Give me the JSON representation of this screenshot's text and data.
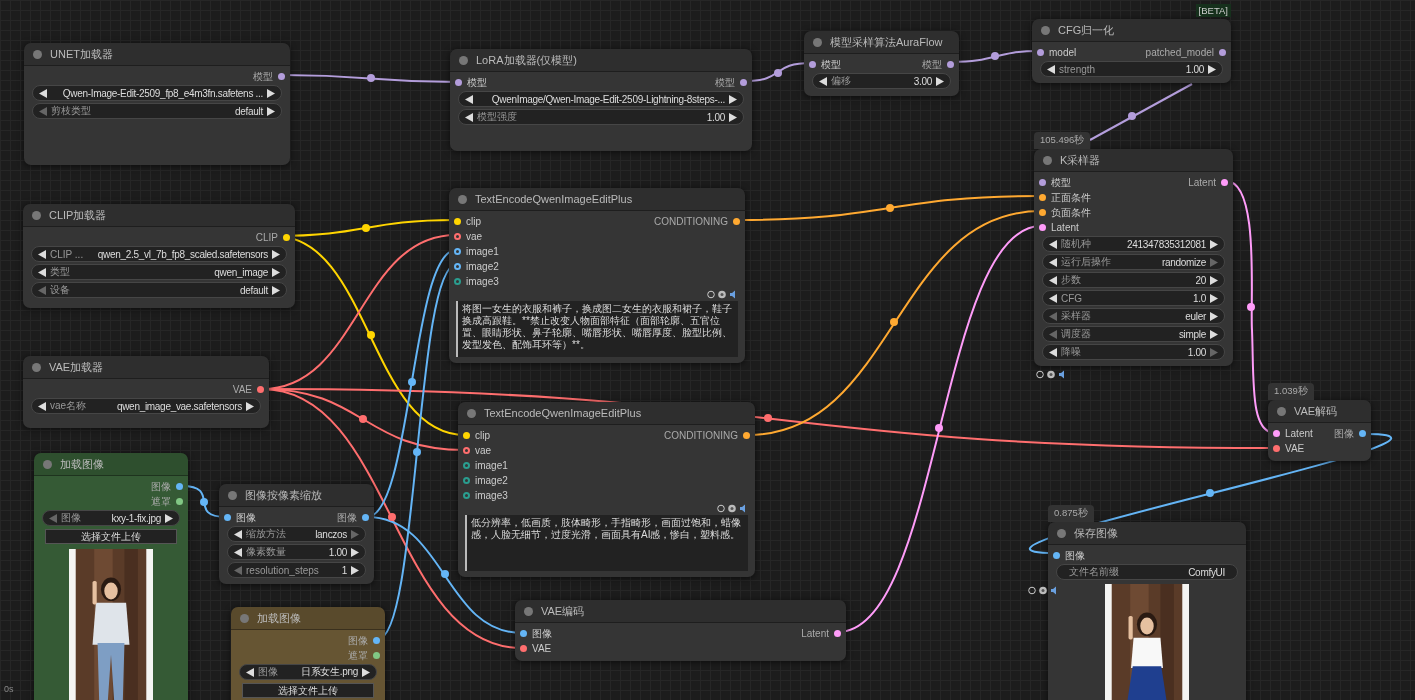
{
  "nodes": [
    {
      "title": "UNET加载器",
      "color": "#353535",
      "outputs": [
        {
          "label": "模型",
          "kind": "MODEL"
        }
      ],
      "widgets": [
        {
          "kind": "stepper",
          "value": "Qwen-Image-Edit-2509_fp8_e4m3fn.safetens ...",
          "left_enabled": true,
          "right_enabled": true
        },
        {
          "kind": "stepper",
          "label": "剪枝类型",
          "value": "default",
          "left_enabled": false,
          "right_enabled": true
        }
      ]
    },
    {
      "title": "LoRA加载器(仅模型)",
      "color": "#353535",
      "inputs": [
        {
          "label": "模型",
          "kind": "MODEL"
        }
      ],
      "outputs": [
        {
          "label": "模型",
          "kind": "MODEL"
        }
      ],
      "widgets": [
        {
          "kind": "stepper",
          "value": "QwenImage/Qwen-Image-Edit-2509-Lightning-8steps-...",
          "left_enabled": true,
          "right_enabled": true
        },
        {
          "kind": "stepper",
          "label": "模型强度",
          "value": "1.00",
          "left_enabled": true,
          "right_enabled": true
        }
      ]
    },
    {
      "title": "模型采样算法AuraFlow",
      "color": "#353535",
      "inputs": [
        {
          "label": "模型",
          "kind": "MODEL"
        }
      ],
      "outputs": [
        {
          "label": "模型",
          "kind": "MODEL"
        }
      ],
      "widgets": [
        {
          "kind": "stepper",
          "label": "偏移",
          "value": "3.00",
          "left_enabled": true,
          "right_enabled": true
        }
      ]
    },
    {
      "title": "CFG归一化",
      "color": "#353535",
      "tag": "[BETA]",
      "inputs": [
        {
          "label": "model",
          "kind": "MODEL"
        }
      ],
      "outputs": [
        {
          "label": "patched_model",
          "kind": "MODEL"
        }
      ],
      "widgets": [
        {
          "kind": "stepper",
          "label": "strength",
          "value": "1.00",
          "left_enabled": true,
          "right_enabled": true
        }
      ]
    },
    {
      "title": "CLIP加载器",
      "color": "#353535",
      "outputs": [
        {
          "label": "CLIP",
          "kind": "CLIP"
        }
      ],
      "widgets": [
        {
          "kind": "stepper",
          "label": "CLIP ...",
          "value": "qwen_2.5_vl_7b_fp8_scaled.safetensors",
          "left_enabled": true,
          "right_enabled": true
        },
        {
          "kind": "stepper",
          "label": "类型",
          "value": "qwen_image",
          "left_enabled": true,
          "right_enabled": true
        },
        {
          "kind": "stepper",
          "label": "设备",
          "value": "default",
          "left_enabled": false,
          "right_enabled": true
        }
      ]
    },
    {
      "title": "TextEncodeQwenImageEditPlus",
      "color": "#353535",
      "badges": {
        "kind": "inside"
      },
      "inputs": [
        {
          "label": "clip",
          "kind": "CLIP"
        },
        {
          "label": "vae",
          "kind": "VAE",
          "optional": true,
          "linked": true
        },
        {
          "label": "image1",
          "kind": "IMAGE",
          "optional": true,
          "linked": true
        },
        {
          "label": "image2",
          "kind": "IMAGE",
          "optional": true,
          "linked": true
        },
        {
          "label": "image3",
          "kind": "IMAGE",
          "optional": true,
          "linked": false
        }
      ],
      "outputs": [
        {
          "label": "CONDITIONING",
          "kind": "CONDITIONING"
        }
      ],
      "prompt": "将图一女生的衣服和裤子，换成图二女生的衣服和裙子，鞋子换成高跟鞋。**禁止改变人物面部特征（面部轮廓、五官位置、眼睛形状、鼻子轮廓、嘴唇形状、嘴唇厚度、脸型比例、发型发色、配饰耳环等）**。"
    },
    {
      "title": "K采样器",
      "color": "#353535",
      "time": "105.496秒",
      "badges": {
        "kind": "below"
      },
      "inputs": [
        {
          "label": "模型",
          "kind": "MODEL"
        },
        {
          "label": "正面条件",
          "kind": "CONDITIONING"
        },
        {
          "label": "负面条件",
          "kind": "CONDITIONING"
        },
        {
          "label": "Latent",
          "kind": "LATENT"
        }
      ],
      "outputs": [
        {
          "label": "Latent",
          "kind": "LATENT"
        }
      ],
      "widgets": [
        {
          "kind": "stepper",
          "label": "随机种",
          "value": "241347835312081",
          "left_enabled": true,
          "right_enabled": true
        },
        {
          "kind": "stepper",
          "label": "运行后操作",
          "value": "randomize",
          "left_enabled": true,
          "right_enabled": false
        },
        {
          "kind": "stepper",
          "label": "步数",
          "value": "20",
          "left_enabled": true,
          "right_enabled": true
        },
        {
          "kind": "stepper",
          "label": "CFG",
          "value": "1.0",
          "left_enabled": true,
          "right_enabled": true
        },
        {
          "kind": "stepper",
          "label": "采样器",
          "value": "euler",
          "left_enabled": false,
          "right_enabled": true
        },
        {
          "kind": "stepper",
          "label": "调度器",
          "value": "simple",
          "left_enabled": false,
          "right_enabled": true
        },
        {
          "kind": "stepper",
          "label": "降噪",
          "value": "1.00",
          "left_enabled": true,
          "right_enabled": false
        }
      ]
    },
    {
      "title": "VAE加载器",
      "color": "#353535",
      "outputs": [
        {
          "label": "VAE",
          "kind": "VAE"
        }
      ],
      "widgets": [
        {
          "kind": "stepper",
          "label": "vae名称",
          "value": "qwen_image_vae.safetensors",
          "left_enabled": true,
          "right_enabled": true
        }
      ]
    },
    {
      "title": "TextEncodeQwenImageEditPlus",
      "color": "#353535",
      "badges": {
        "kind": "inside"
      },
      "inputs": [
        {
          "label": "clip",
          "kind": "CLIP"
        },
        {
          "label": "vae",
          "kind": "VAE",
          "optional": true,
          "linked": true
        },
        {
          "label": "image1",
          "kind": "IMAGE",
          "optional": true,
          "linked": false
        },
        {
          "label": "image2",
          "kind": "IMAGE",
          "optional": true,
          "linked": false
        },
        {
          "label": "image3",
          "kind": "IMAGE",
          "optional": true,
          "linked": false
        }
      ],
      "outputs": [
        {
          "label": "CONDITIONING",
          "kind": "CONDITIONING"
        }
      ],
      "prompt": "低分辨率，低画质，肢体畸形，手指畸形，画面过饱和，蜡像感，人脸无细节，过度光滑，画面具有AI感，惨白，塑料感。"
    },
    {
      "title": "VAE解码",
      "color": "#353535",
      "time": "1.039秒",
      "inputs": [
        {
          "label": "Latent",
          "kind": "LATENT"
        },
        {
          "label": "VAE",
          "kind": "VAE"
        }
      ],
      "outputs": [
        {
          "label": "图像",
          "kind": "IMAGE"
        }
      ]
    },
    {
      "title": "加载图像",
      "color": "#355a35",
      "outputs": [
        {
          "label": "图像",
          "kind": "IMAGE"
        },
        {
          "label": "遮罩",
          "kind": "MASK"
        }
      ],
      "widgets": [
        {
          "kind": "stepper",
          "label": "图像",
          "value": "kxy-1-fix.jpg",
          "left_enabled": false,
          "right_enabled": true
        }
      ],
      "button": "选择文件上传",
      "preview": {
        "kind": "picture"
      }
    },
    {
      "title": "图像按像素缩放",
      "color": "#353535",
      "inputs": [
        {
          "label": "图像",
          "kind": "IMAGE"
        }
      ],
      "outputs": [
        {
          "label": "图像",
          "kind": "IMAGE"
        }
      ],
      "widgets": [
        {
          "kind": "stepper",
          "label": "缩放方法",
          "value": "lanczos",
          "left_enabled": true,
          "right_enabled": false
        },
        {
          "kind": "stepper",
          "label": "像素数量",
          "value": "1.00",
          "left_enabled": true,
          "right_enabled": true
        },
        {
          "kind": "stepper",
          "label": "resolution_steps",
          "value": "1",
          "left_enabled": false,
          "right_enabled": true
        }
      ]
    },
    {
      "title": "加载图像",
      "color": "#665533",
      "outputs": [
        {
          "label": "图像",
          "kind": "IMAGE"
        },
        {
          "label": "遮罩",
          "kind": "MASK"
        }
      ],
      "widgets": [
        {
          "kind": "stepper",
          "label": "图像",
          "value": "日系女生.png",
          "left_enabled": true,
          "right_enabled": true
        }
      ],
      "button": "选择文件上传"
    },
    {
      "title": "VAE编码",
      "color": "#353535",
      "inputs": [
        {
          "label": "图像",
          "kind": "IMAGE"
        },
        {
          "label": "VAE",
          "kind": "VAE"
        }
      ],
      "outputs": [
        {
          "label": "Latent",
          "kind": "LATENT"
        }
      ]
    },
    {
      "title": "保存图像",
      "color": "#353535",
      "time": "0.875秒",
      "badges": {
        "kind": "left"
      },
      "inputs": [
        {
          "label": "图像",
          "kind": "IMAGE"
        }
      ],
      "widgets": [
        {
          "kind": "text",
          "label": "文件名前缀",
          "value": "ComfyUI"
        }
      ],
      "preview": {
        "kind": "picture"
      }
    }
  ],
  "corner_label": "0s"
}
